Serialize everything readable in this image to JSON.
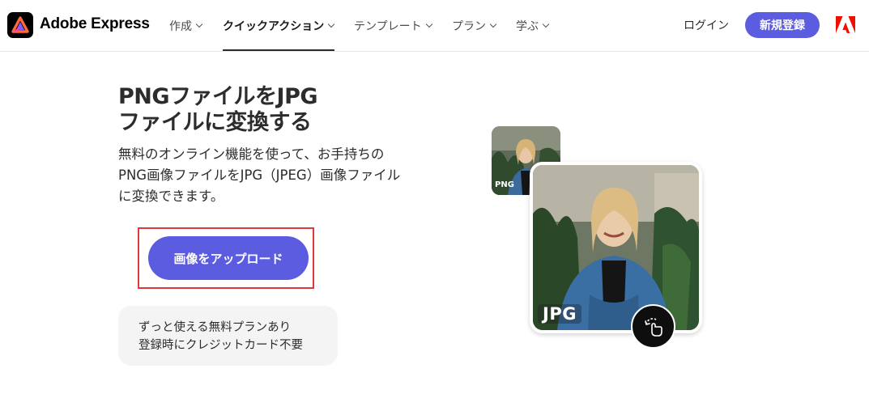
{
  "header": {
    "brand": "Adobe Express",
    "nav": [
      {
        "label": "作成"
      },
      {
        "label": "クイックアクション"
      },
      {
        "label": "テンプレート"
      },
      {
        "label": "プラン"
      },
      {
        "label": "学ぶ"
      }
    ],
    "login": "ログイン",
    "signup": "新規登録"
  },
  "hero": {
    "title_line1": "PNGファイルをJPG",
    "title_line2": "ファイルに変換する",
    "desc_line1": "無料のオンライン機能を使って、お手持ちの",
    "desc_line2": "PNG画像ファイルをJPG（JPEG）画像ファイル",
    "desc_line3": "に変換できます。",
    "upload_label": "画像をアップロード",
    "plan_line1": "ずっと使える無料プランあり",
    "plan_line2": "登録時にクレジットカード不要"
  },
  "preview": {
    "small_tag": "PNG",
    "big_tag": "JPG"
  },
  "colors": {
    "accent": "#5c5ce0",
    "highlight_border": "#e0383e",
    "adobe_red": "#eb1000"
  }
}
